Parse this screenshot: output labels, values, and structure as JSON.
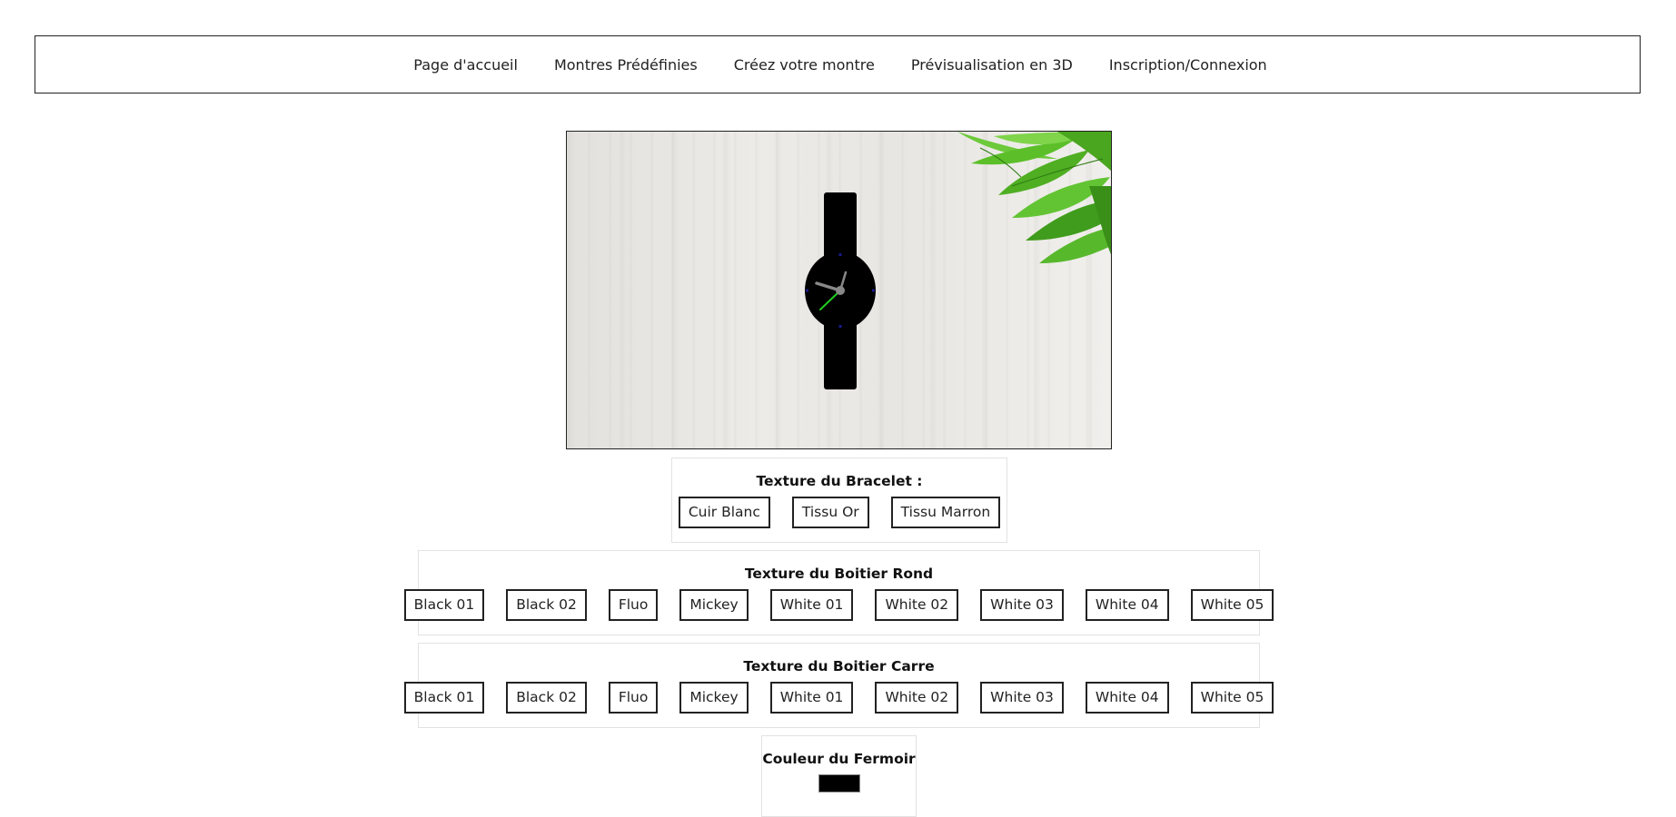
{
  "nav": {
    "items": [
      "Page d'accueil",
      "Montres Prédéfinies",
      "Créez votre montre",
      "Prévisualisation en 3D",
      "Inscription/Connexion"
    ]
  },
  "bracelet": {
    "title": "Texture du Bracelet :",
    "options": [
      "Cuir Blanc",
      "Tissu Or",
      "Tissu Marron"
    ]
  },
  "boitier_rond": {
    "title": "Texture du Boitier Rond",
    "options": [
      "Black 01",
      "Black 02",
      "Fluo",
      "Mickey",
      "White 01",
      "White 02",
      "White 03",
      "White 04",
      "White 05"
    ]
  },
  "boitier_carre": {
    "title": "Texture du Boitier Carre",
    "options": [
      "Black 01",
      "Black 02",
      "Fluo",
      "Mickey",
      "White 01",
      "White 02",
      "White 03",
      "White 04",
      "White 05"
    ]
  },
  "fermoir": {
    "title": "Couleur du Fermoir",
    "color": "#000000"
  },
  "colors": {
    "watch_body": "#000000",
    "second_hand": "#22cc22",
    "hour_minute_hands": "#888888",
    "hour_markers": "#1a1a8c",
    "leaves": "#5cbf2a"
  }
}
